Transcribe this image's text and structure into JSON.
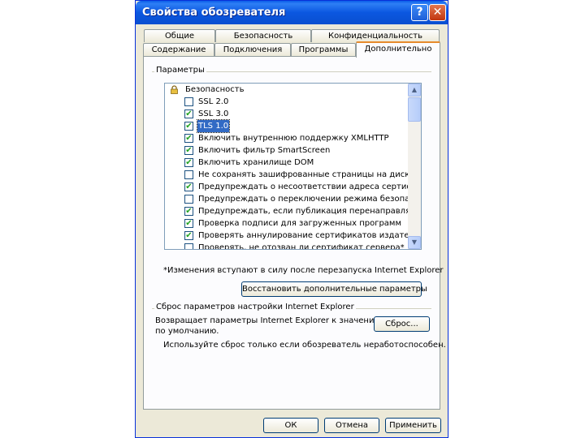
{
  "window": {
    "title": "Свойства обозревателя"
  },
  "tabs_top": [
    "Общие",
    "Безопасность",
    "Конфиденциальность"
  ],
  "tabs_bottom": [
    "Содержание",
    "Подключения",
    "Программы",
    "Дополнительно"
  ],
  "settings": {
    "group_label": "Параметры",
    "category": "Безопасность",
    "items": [
      {
        "label": "SSL 2.0",
        "checked": false,
        "selected": false
      },
      {
        "label": "SSL 3.0",
        "checked": true,
        "selected": false
      },
      {
        "label": "TLS 1.0",
        "checked": true,
        "selected": true
      },
      {
        "label": "Включить внутреннюю поддержку XMLHTTP",
        "checked": true,
        "selected": false
      },
      {
        "label": "Включить фильтр SmartScreen",
        "checked": true,
        "selected": false
      },
      {
        "label": "Включить хранилище DOM",
        "checked": true,
        "selected": false
      },
      {
        "label": "Не сохранять зашифрованные страницы на диск",
        "checked": false,
        "selected": false
      },
      {
        "label": "Предупреждать о несоответствии адреса сертификата",
        "checked": true,
        "selected": false
      },
      {
        "label": "Предупреждать о переключении режима безопасности",
        "checked": false,
        "selected": false
      },
      {
        "label": "Предупреждать, если публикация перенаправляется",
        "checked": true,
        "selected": false
      },
      {
        "label": "Проверка подписи для загруженных программ",
        "checked": true,
        "selected": false
      },
      {
        "label": "Проверять аннулирование сертификатов издателей",
        "checked": true,
        "selected": false
      },
      {
        "label": "Проверять, не отозван ли сертификат сервера*",
        "checked": false,
        "selected": false
      }
    ],
    "note": "*Изменения вступают в силу после перезапуска Internet Explorer",
    "restore_button": "Восстановить дополнительные параметры"
  },
  "reset": {
    "group_label": "Сброс параметров настройки Internet Explorer",
    "description_line1": "Возвращает параметры Internet Explorer к значениям",
    "description_line2": "по умолчанию.",
    "button": "Сброс...",
    "hint": "Используйте сброс только если обозреватель неработоспособен."
  },
  "footer": {
    "ok": "ОК",
    "cancel": "Отмена",
    "apply": "Применить"
  },
  "icons": {
    "help": "help-icon",
    "close": "close-icon",
    "lock": "lock-icon",
    "scroll_up": "scroll-up-arrow-icon",
    "scroll_down": "scroll-down-arrow-icon",
    "check": "check-icon"
  }
}
